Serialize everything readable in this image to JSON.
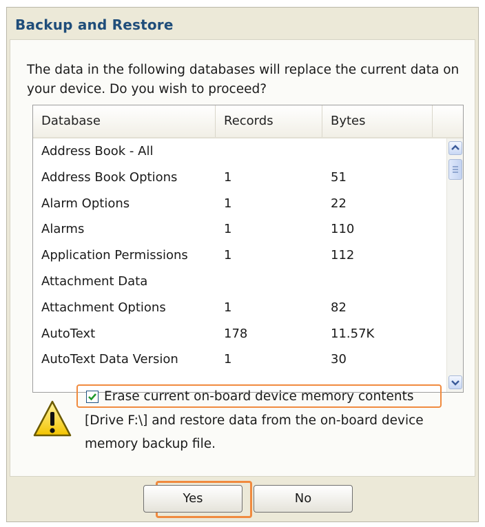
{
  "dialog": {
    "title": "Backup and Restore",
    "message": "The data in the following databases will replace the current data on your device. Do you wish to proceed?"
  },
  "table": {
    "columns": [
      "Database",
      "Records",
      "Bytes"
    ],
    "rows": [
      [
        "Address Book - All",
        "",
        ""
      ],
      [
        "Address Book Options",
        "1",
        "51"
      ],
      [
        "Alarm Options",
        "1",
        "22"
      ],
      [
        "Alarms",
        "1",
        "110"
      ],
      [
        "Application Permissions",
        "1",
        "112"
      ],
      [
        "Attachment Data",
        "",
        ""
      ],
      [
        "Attachment Options",
        "1",
        "82"
      ],
      [
        "AutoText",
        "178",
        "11.57K"
      ],
      [
        "AutoText Data Version",
        "1",
        "30"
      ]
    ]
  },
  "erase": {
    "checked": true,
    "label": "Erase current on-board device memory contents",
    "continuation": "[Drive F:\\] and restore data from the on-board device memory backup file."
  },
  "buttons": {
    "yes": "Yes",
    "no": "No"
  },
  "colors": {
    "highlight": "#f08a3e",
    "title": "#1f4d7a",
    "dialog_bg": "#ece9d8"
  },
  "icons": {
    "warning": "warning-icon",
    "scroll_up": "chevron-up-icon",
    "scroll_down": "chevron-down-icon",
    "check": "check-icon"
  }
}
